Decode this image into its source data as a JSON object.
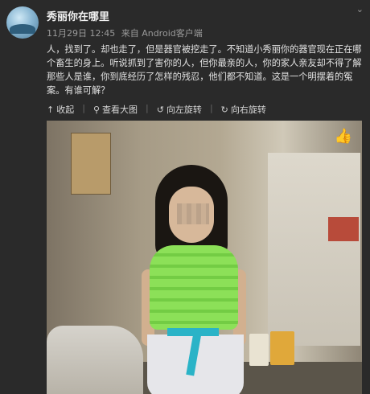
{
  "user": {
    "name": "秀丽你在哪里",
    "time": "11月29日 12:45",
    "source": "来自 Android客户端"
  },
  "post": {
    "text": "人，找到了。却也走了，但是器官被挖走了。不知道小秀丽你的器官现在正在哪个畜生的身上。听说抓到了害你的人，但你最亲的人，你的家人亲友却不得了解那些人是谁，你到底经历了怎样的残忍，他们都不知道。这是一个明摆着的冤案。有谁可解？"
  },
  "actions": {
    "collapse": "收起",
    "view_large": "查看大图",
    "rotate_left": "向左旋转",
    "rotate_right": "向右旋转"
  },
  "icons": {
    "collapse": "up-arrow-icon",
    "view_large": "magnifier-icon",
    "rotate_left": "rotate-left-icon",
    "rotate_right": "rotate-right-icon",
    "like": "thumbs-up-icon",
    "menu": "chevron-down-icon"
  }
}
